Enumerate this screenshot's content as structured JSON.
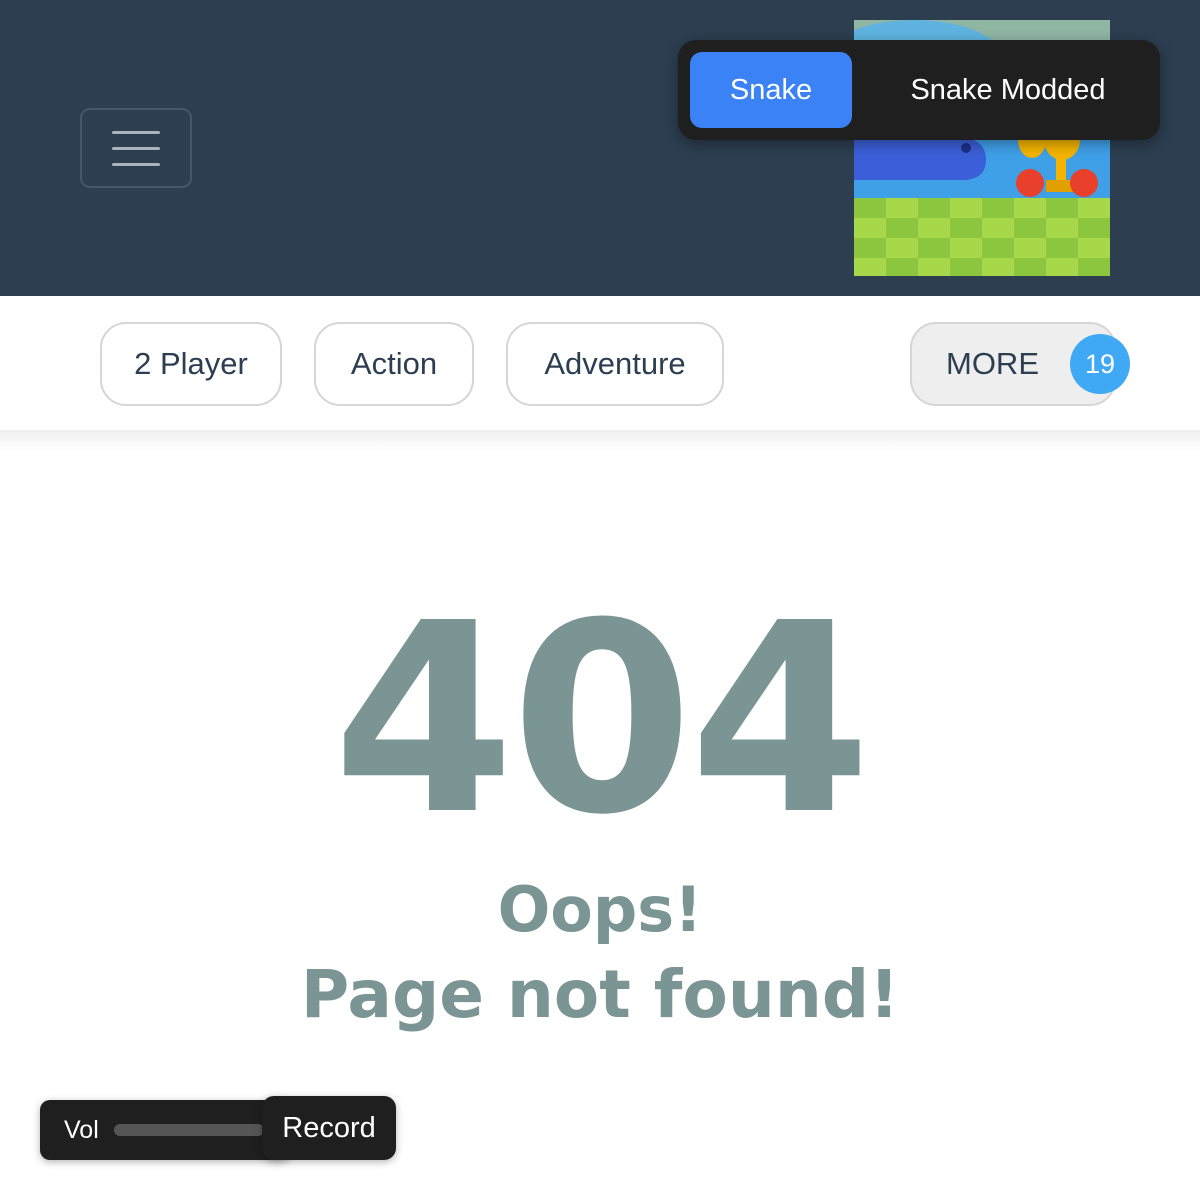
{
  "header": {
    "menu_icon": "hamburger-menu-icon",
    "thumbnail_icon": "snake-game-thumbnail"
  },
  "game_tabs": {
    "items": [
      {
        "label": "Snake",
        "active": true
      },
      {
        "label": "Snake Modded",
        "active": false
      }
    ],
    "active_color": "#3b82f6"
  },
  "categories": {
    "items": [
      "2 Player",
      "Action",
      "Adventure"
    ],
    "more_label": "MORE",
    "more_count": "19"
  },
  "error": {
    "code": "404",
    "title": "Oops!",
    "message": "Page not found!",
    "color": "#7a9594"
  },
  "controls": {
    "vol_label": "Vol",
    "volume_level": 0,
    "record_label": "Record"
  },
  "colors": {
    "header_bg": "#2c3e50",
    "badge": "#3fa9f5"
  }
}
